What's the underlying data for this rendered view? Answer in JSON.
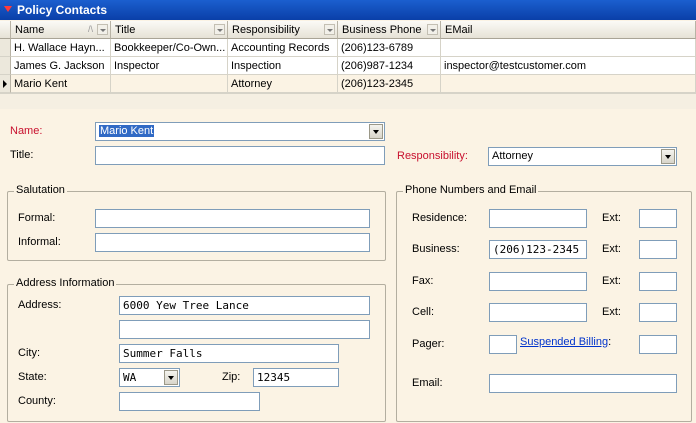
{
  "panel": {
    "title": "Policy Contacts"
  },
  "grid": {
    "columns": [
      "Name",
      "Title",
      "Responsibility",
      "Business Phone",
      "EMail"
    ],
    "rows": [
      {
        "name": "H. Wallace Hayn...",
        "title": "Bookkeeper/Co-Own...",
        "responsibility": "Accounting Records",
        "phone": "(206)123-6789",
        "email": ""
      },
      {
        "name": "James G. Jackson",
        "title": "Inspector",
        "responsibility": "Inspection",
        "phone": "(206)987-1234",
        "email": "inspector@testcustomer.com"
      },
      {
        "name": "Mario Kent",
        "title": "",
        "responsibility": "Attorney",
        "phone": "(206)123-2345",
        "email": ""
      }
    ]
  },
  "form": {
    "name_label": "Name:",
    "name_value": "Mario Kent",
    "title_label": "Title:",
    "title_value": "",
    "responsibility_label": "Responsibility:",
    "responsibility_value": "Attorney",
    "salutation": {
      "legend": "Salutation",
      "formal_label": "Formal:",
      "formal_value": "",
      "informal_label": "Informal:",
      "informal_value": ""
    },
    "address": {
      "legend": "Address Information",
      "address_label": "Address:",
      "address1": "6000 Yew Tree Lance",
      "address2": "",
      "city_label": "City:",
      "city": "Summer Falls",
      "state_label": "State:",
      "state": "WA",
      "zip_label": "Zip:",
      "zip": "12345",
      "county_label": "County:",
      "county": ""
    },
    "phones": {
      "legend": "Phone Numbers and Email",
      "residence_label": "Residence:",
      "residence": "",
      "business_label": "Business:",
      "business": "(206)123-2345",
      "fax_label": "Fax:",
      "fax": "",
      "cell_label": "Cell:",
      "cell": "",
      "pager_label": "Pager:",
      "pager": "",
      "ext_label": "Ext:",
      "suspended_billing": "Suspended Billing",
      "link_colon": ":",
      "email_label": "Email:",
      "email": ""
    }
  }
}
